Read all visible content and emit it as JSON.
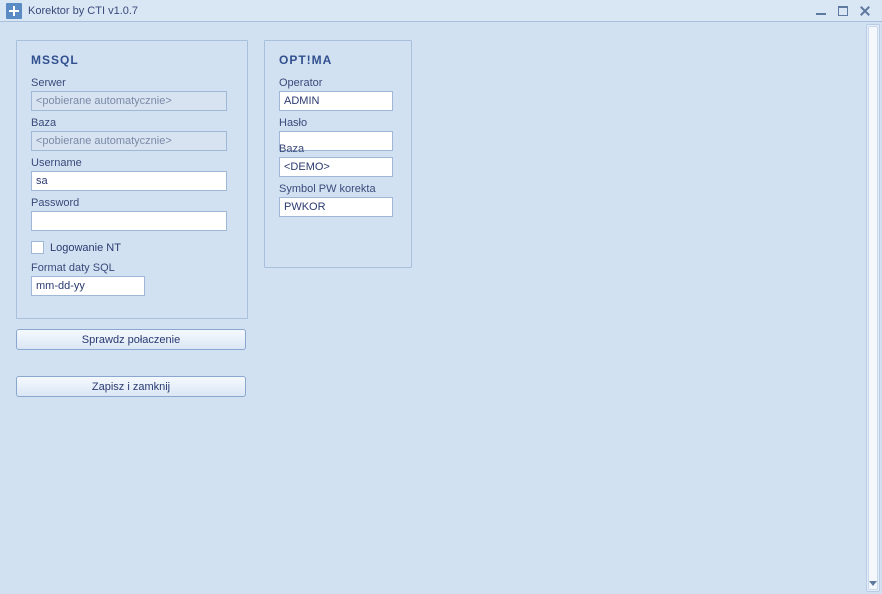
{
  "window": {
    "title": "Korektor by CTI v1.0.7"
  },
  "mssql": {
    "title": "MSSQL",
    "server_label": "Serwer",
    "server_value": "<pobierane automatycznie>",
    "baza_label": "Baza",
    "baza_value": "<pobierane automatycznie>",
    "username_label": "Username",
    "username_value": "sa",
    "password_label": "Password",
    "password_value": "",
    "logowanie_nt_label": "Logowanie NT",
    "format_daty_label": "Format daty SQL",
    "format_daty_value": "mm-dd-yy"
  },
  "optima": {
    "title": "OPT!MA",
    "operator_label": "Operator",
    "operator_value": "ADMIN",
    "haslo_label": "Hasło",
    "haslo_value": "",
    "baza_label": "Baza",
    "baza_value": "<DEMO>",
    "symbolpw_label": "Symbol PW korekta",
    "symbolpw_value": "PWKOR"
  },
  "buttons": {
    "sprawdz": "Sprawdz połaczenie",
    "zapisz": "Zapisz i zamknij"
  }
}
